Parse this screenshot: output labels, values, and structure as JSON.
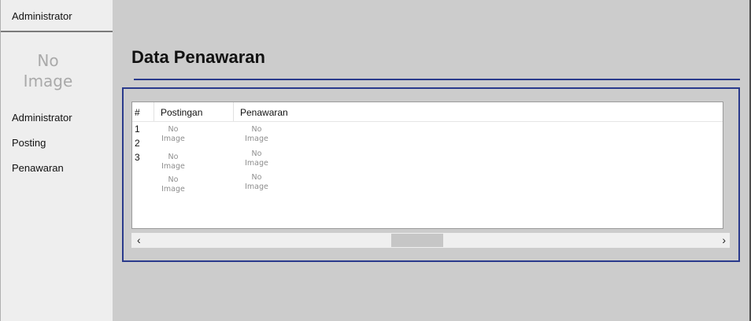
{
  "sidebar": {
    "header_label": "Administrator",
    "avatar_placeholder": [
      "No",
      "Image"
    ],
    "nav_items": [
      {
        "label": "Administrator"
      },
      {
        "label": "Posting"
      },
      {
        "label": "Penawaran"
      }
    ]
  },
  "main": {
    "title": "Data Penawaran",
    "table": {
      "columns": [
        "#",
        "Postingan",
        "Penawaran"
      ],
      "row_numbers": [
        "1",
        "2",
        "3"
      ],
      "placeholder": [
        "No",
        "Image"
      ]
    },
    "scrollbar": {
      "left_arrow": "‹",
      "right_arrow": "›"
    }
  },
  "colors": {
    "accent_border": "#2a3a8c",
    "background": "#cccccc",
    "sidebar_bg": "#eeeeee"
  }
}
